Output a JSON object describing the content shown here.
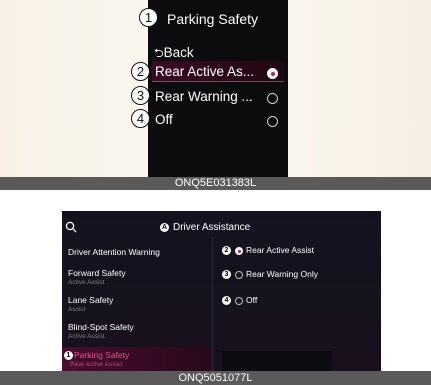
{
  "figure1": {
    "callouts": [
      "1",
      "2",
      "3",
      "4"
    ],
    "title": "Parking Safety",
    "back_label": "Back",
    "options": [
      {
        "label": "Rear Active As...",
        "selected": true
      },
      {
        "label": "Rear Warning ...",
        "selected": false
      },
      {
        "label": "Off",
        "selected": false
      }
    ],
    "caption": "ONQ5E031383L"
  },
  "figure2": {
    "title_badge": "A",
    "title": "Driver Assistance",
    "menu": [
      {
        "label": "Driver Attention Warning",
        "sub": ""
      },
      {
        "label": "Forward Safety",
        "sub": "Active Assist"
      },
      {
        "label": "Lane Safety",
        "sub": "Assist"
      },
      {
        "label": "Blind-Spot Safety",
        "sub": "Active Assist"
      },
      {
        "label": "Parking Safety",
        "sub": "Rear Active Assist",
        "selected": true
      }
    ],
    "menu_selected_badge": "1",
    "options": [
      {
        "badge": "2",
        "label": "Rear Active Assist",
        "selected": true
      },
      {
        "badge": "3",
        "label": "Rear Warning Only",
        "selected": false
      },
      {
        "badge": "4",
        "label": "Off",
        "selected": false
      }
    ],
    "caption": "ONQ5051077L"
  },
  "colors": {
    "accent": "#c0165a",
    "screen": "#0c0c0e",
    "caption_bar": "#5a5a5a"
  }
}
